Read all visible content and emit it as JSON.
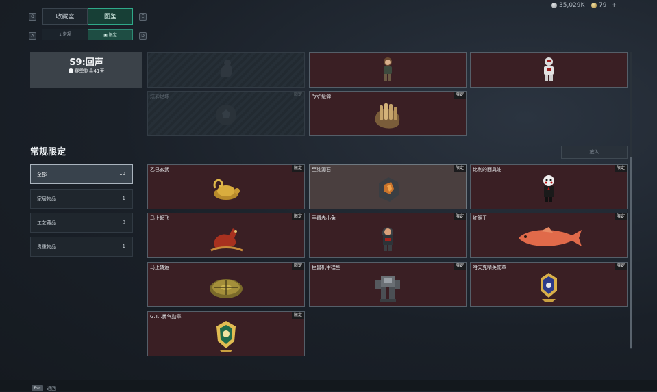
{
  "header": {
    "tabs": [
      {
        "label": "收藏室",
        "active": false
      },
      {
        "label": "图鉴",
        "active": true
      }
    ],
    "tab_left_key": "Q",
    "tab_right_key": "E",
    "subtabs": [
      {
        "label": "常规",
        "active": false
      },
      {
        "label": "限定",
        "active": true
      }
    ],
    "subtab_left_key": "A",
    "subtab_right_key": "D",
    "currency": [
      {
        "icon": "silver-coin-icon",
        "value": "35,029K"
      },
      {
        "icon": "gold-coin-icon",
        "value": "79",
        "add": "+"
      }
    ]
  },
  "season": {
    "title": "S9:回声",
    "remaining": "赛季剩余41天"
  },
  "top_cards": [
    {
      "name": "",
      "tag": "",
      "icon": "locked-figure-icon",
      "style": "grey"
    },
    {
      "name": "",
      "tag": "",
      "icon": "adventurer-figurine-icon",
      "style": "red"
    },
    {
      "name": "",
      "tag": "",
      "icon": "armored-figurine-icon",
      "style": "red"
    },
    {
      "name": "炫彩足球",
      "tag": "限定",
      "icon": "football-icon",
      "style": "grey"
    },
    {
      "name": "“六”级弹",
      "tag": "限定",
      "icon": "bullet-hand-icon",
      "style": "red"
    }
  ],
  "section": {
    "title": "常规限定",
    "button": "放入"
  },
  "categories": [
    {
      "label": "全部",
      "count": "10",
      "active": true
    },
    {
      "label": "家居物品",
      "count": "1",
      "active": false
    },
    {
      "label": "工艺藏品",
      "count": "8",
      "active": false
    },
    {
      "label": "贵重物品",
      "count": "1",
      "active": false
    }
  ],
  "items": [
    {
      "name": "乙巳玄武",
      "tag": "限定",
      "icon": "golden-tortoise-icon",
      "style": "red"
    },
    {
      "name": "至纯源石",
      "tag": "限定",
      "icon": "source-stone-icon",
      "style": "hi"
    },
    {
      "name": "比利的面具娃",
      "tag": "限定",
      "icon": "masked-doll-icon",
      "style": "red"
    },
    {
      "name": "马上起飞",
      "tag": "限定",
      "icon": "red-horse-icon",
      "style": "red"
    },
    {
      "name": "手臂赤小兔",
      "tag": "限定",
      "icon": "hooded-figure-icon",
      "style": "red"
    },
    {
      "name": "红鲤王",
      "tag": "限定",
      "icon": "red-carp-icon",
      "style": "red"
    },
    {
      "name": "马上转运",
      "tag": "限定",
      "icon": "compass-disc-icon",
      "style": "red"
    },
    {
      "name": "巨兽机甲模型",
      "tag": "限定",
      "icon": "mech-model-icon",
      "style": "red"
    },
    {
      "name": "哈夫克精英勋章",
      "tag": "限定",
      "icon": "elite-medal-icon",
      "style": "red"
    },
    {
      "name": "G.T.I.勇气勋章",
      "tag": "限定",
      "icon": "courage-medal-icon",
      "style": "red"
    }
  ],
  "footer": {
    "key": "Esc",
    "label": "返回"
  },
  "colors": {
    "accent": "#2fa889",
    "card_red": "#3a1f24",
    "card_highlight": "#4a3f3f"
  }
}
